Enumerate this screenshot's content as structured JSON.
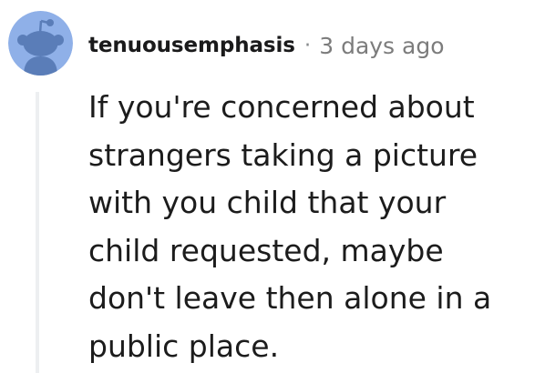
{
  "comment": {
    "author": "tenuousemphasis",
    "separator": "·",
    "timestamp": "3 days ago",
    "body": "If you're concerned about\nstrangers taking a picture\nwith you child that your\nchild requested, maybe\ndon't leave then alone in a\npublic place."
  },
  "icons": {
    "avatar": "snoo-avatar-icon"
  },
  "colors": {
    "avatar_bg": "#8fb0e8",
    "avatar_figure": "#5a7db8",
    "thread_line": "#edeff1",
    "username": "#1a1a1b",
    "meta": "#7c7c7c",
    "body_text": "#1c1c1c"
  }
}
